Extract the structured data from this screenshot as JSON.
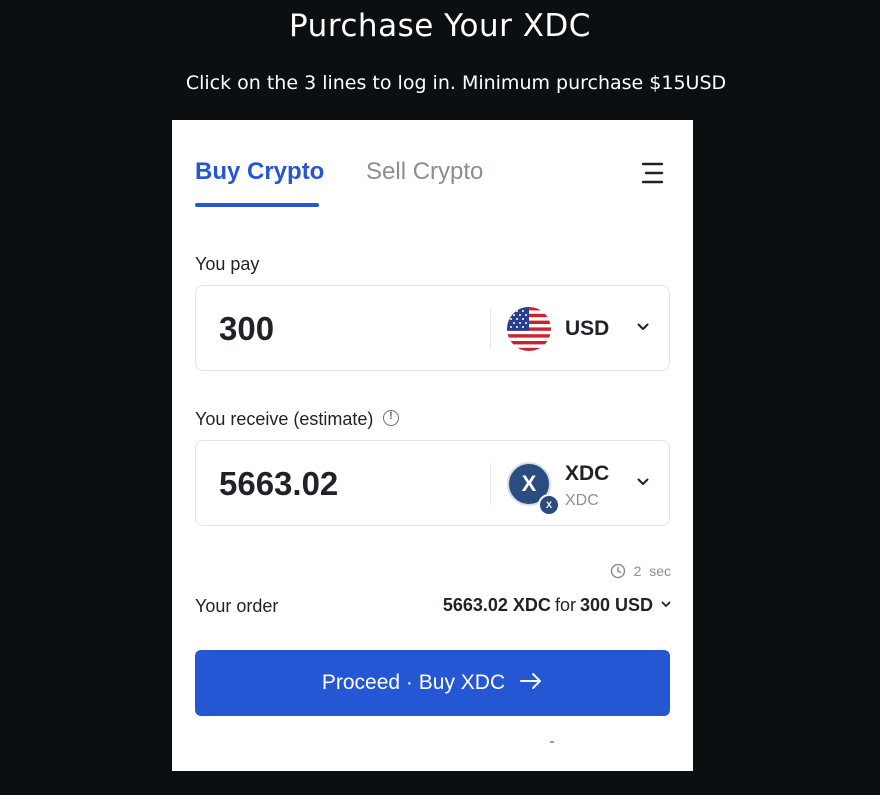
{
  "page": {
    "title": "Purchase Your XDC",
    "subtitle": "Click on the 3 lines to log in. Minimum purchase $15USD"
  },
  "tabs": [
    {
      "label": "Buy Crypto",
      "active": true
    },
    {
      "label": "Sell Crypto",
      "active": false
    }
  ],
  "menu_icon": "hamburger-icon",
  "pay": {
    "label": "You pay",
    "amount": "300",
    "currency": "USD",
    "currency_icon": "us-flag-icon"
  },
  "receive": {
    "label": "You receive (estimate)",
    "amount": "5663.02",
    "currency": "XDC",
    "currency_network": "XDC",
    "currency_icon": "xdc-logo-icon",
    "logo_letter": "X",
    "network_letter": "X"
  },
  "timer": {
    "value": "2",
    "unit": "sec"
  },
  "order": {
    "label": "Your order",
    "crypto_amount": "5663.02 XDC",
    "for": "for",
    "fiat_amount": "300 USD"
  },
  "cta": {
    "label": "Proceed · Buy XDC"
  },
  "colors": {
    "accent": "#2556d4",
    "background": "#0b0f12",
    "xdc_logo": "#2a4c7e"
  }
}
